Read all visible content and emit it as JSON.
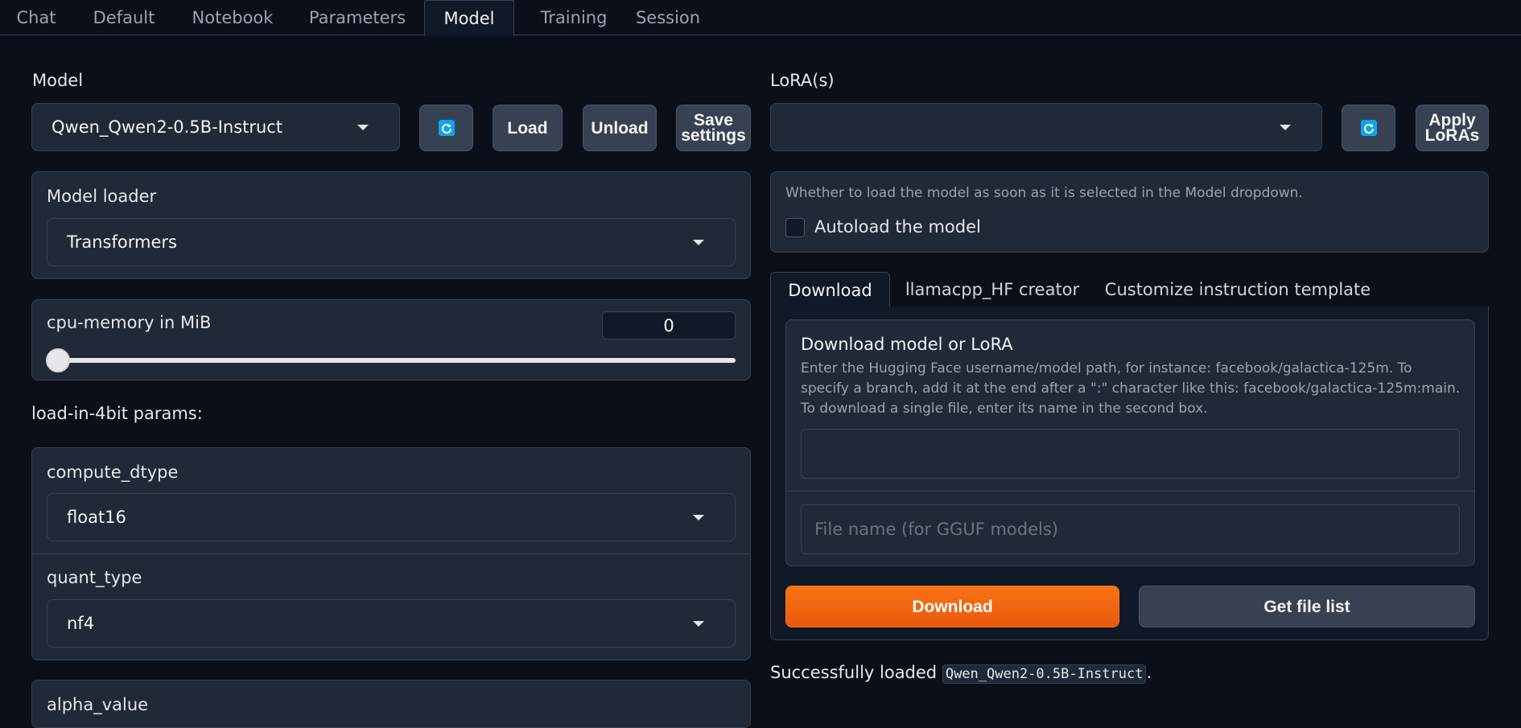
{
  "tabs": [
    "Chat",
    "Default",
    "Notebook",
    "Parameters",
    "Model",
    "Training",
    "Session"
  ],
  "active_tab": "Model",
  "model": {
    "label": "Model",
    "selected": "Qwen_Qwen2-0.5B-Instruct",
    "load_label": "Load",
    "unload_label": "Unload",
    "save_label_line1": "Save",
    "save_label_line2": "settings"
  },
  "lora": {
    "label": "LoRA(s)",
    "selected": "",
    "apply_line1": "Apply",
    "apply_line2": "LoRAs"
  },
  "model_loader": {
    "label": "Model loader",
    "selected": "Transformers"
  },
  "cpu_memory": {
    "label": "cpu-memory in MiB",
    "value": "0",
    "slider_fraction": 0
  },
  "load_in_4bit": {
    "heading": "load-in-4bit params:",
    "compute_dtype_label": "compute_dtype",
    "compute_dtype_value": "float16",
    "quant_type_label": "quant_type",
    "quant_type_value": "nf4",
    "alpha_label": "alpha_value"
  },
  "autoload": {
    "info": "Whether to load the model as soon as it is selected in the Model dropdown.",
    "checkbox_label": "Autoload the model",
    "checked": false
  },
  "subtabs": [
    "Download",
    "llamacpp_HF creator",
    "Customize instruction template"
  ],
  "active_subtab": "Download",
  "download": {
    "title": "Download model or LoRA",
    "description": "Enter the Hugging Face username/model path, for instance: facebook/galactica-125m. To specify a branch, add it at the end after a \":\" character like this: facebook/galactica-125m:main. To download a single file, enter its name in the second box.",
    "path_value": "",
    "file_placeholder": "File name (for GGUF models)",
    "download_button": "Download",
    "file_list_button": "Get file list"
  },
  "status": {
    "prefix": "Successfully loaded",
    "model_name": "Qwen_Qwen2-0.5B-Instruct",
    "suffix": "."
  },
  "colors": {
    "background": "#0b0f19",
    "panel": "#1f2937",
    "accent_orange": "#f97316",
    "refresh_icon": "#0ea5e9"
  }
}
